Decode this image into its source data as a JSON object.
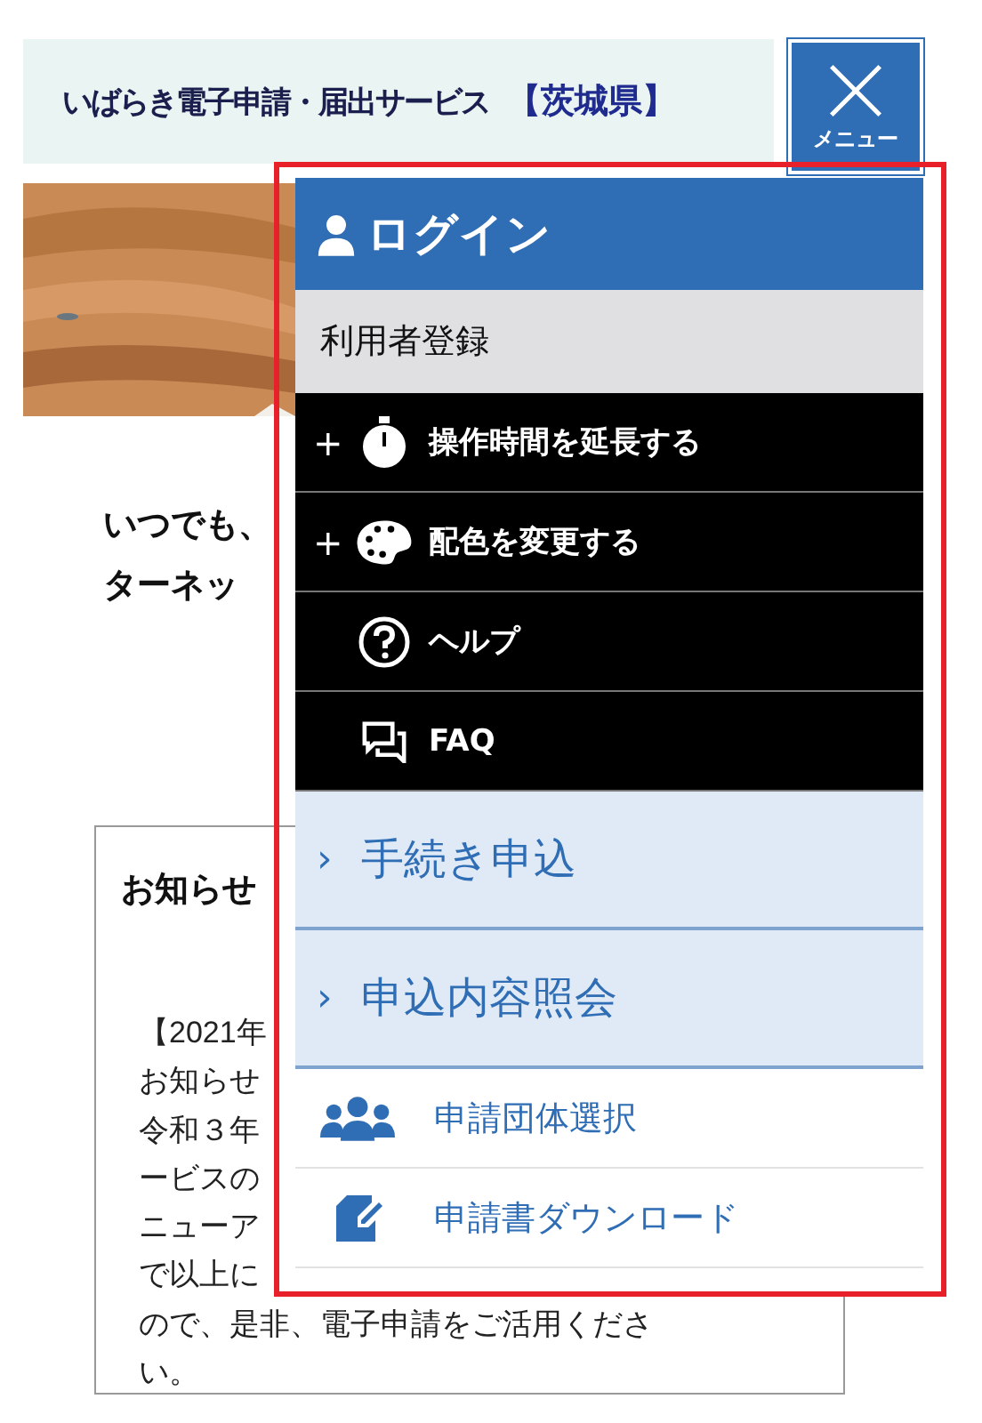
{
  "header": {
    "site_title": "いばらき電子申請・届出サービス",
    "prefecture": "【茨城県】",
    "menu_button": {
      "label": "メニュー",
      "expanded": true
    }
  },
  "intro_lines": [
    "いつでも、",
    "ターネッ"
  ],
  "notice": {
    "title": "お知らせ",
    "lines": [
      "【2021年",
      "お知らせ",
      "令和３年",
      "ービスの",
      "ニューア",
      "で以上に",
      "ので、是非、電子申請をご活用くださ",
      "い。"
    ]
  },
  "menu": {
    "login": "ログイン",
    "register": "利用者登録",
    "tools": [
      {
        "kind": "timer",
        "prefix": "+",
        "label": "操作時間を延長する"
      },
      {
        "kind": "palette",
        "prefix": "+",
        "label": "配色を変更する"
      },
      {
        "kind": "help",
        "label": "ヘルプ"
      },
      {
        "kind": "chat",
        "label": "FAQ"
      }
    ],
    "nav": [
      {
        "chevron": "›",
        "label": "手続き申込"
      },
      {
        "chevron": "›",
        "label": "申込内容照会"
      }
    ],
    "links": [
      {
        "kind": "groups",
        "label": "申請団体選択"
      },
      {
        "kind": "edit",
        "label": "申請書ダウンロード"
      }
    ]
  }
}
